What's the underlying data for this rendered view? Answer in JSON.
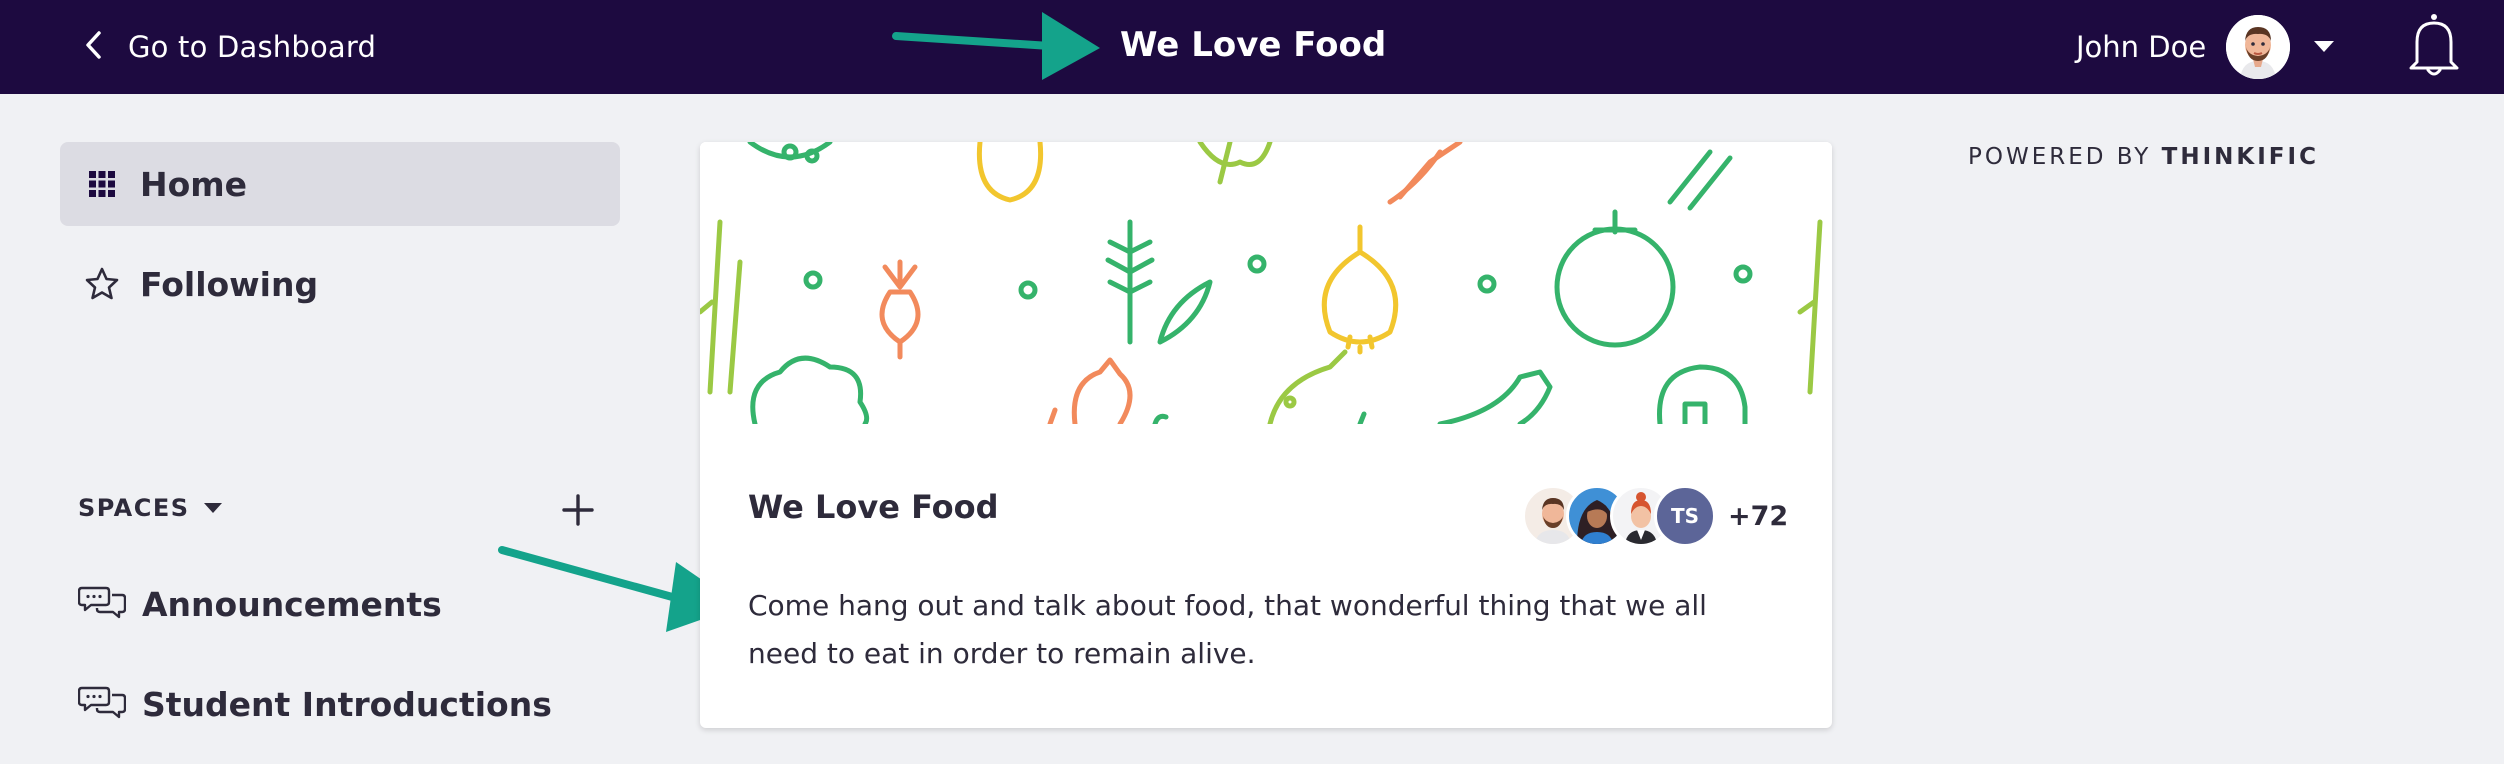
{
  "topbar": {
    "back_label": "Go to Dashboard",
    "community_title": "We Love Food",
    "user_name": "John Doe"
  },
  "sidebar": {
    "nav": [
      {
        "label": "Home",
        "icon": "grid-icon",
        "active": true
      },
      {
        "label": "Following",
        "icon": "star-icon",
        "active": false
      }
    ],
    "spaces_label": "SPACES",
    "spaces": [
      {
        "label": "Announcements",
        "icon": "chat-bubbles-icon"
      },
      {
        "label": "Student Introductions",
        "icon": "chat-bubbles-icon"
      }
    ]
  },
  "card": {
    "title": "We Love Food",
    "description": "Come hang out and talk about food, that wonderful thing that we all need to eat in order to remain alive.",
    "member_initials": "TS",
    "member_extra_count": "+72"
  },
  "footer_brand": {
    "powered_by": "POWERED BY",
    "brand": "THINKIFIC"
  },
  "colors": {
    "topbar": "#1d0a40",
    "annotation_arrow": "#14a38b",
    "page_bg": "#f0f1f4",
    "active_nav": "#dcdce3"
  }
}
